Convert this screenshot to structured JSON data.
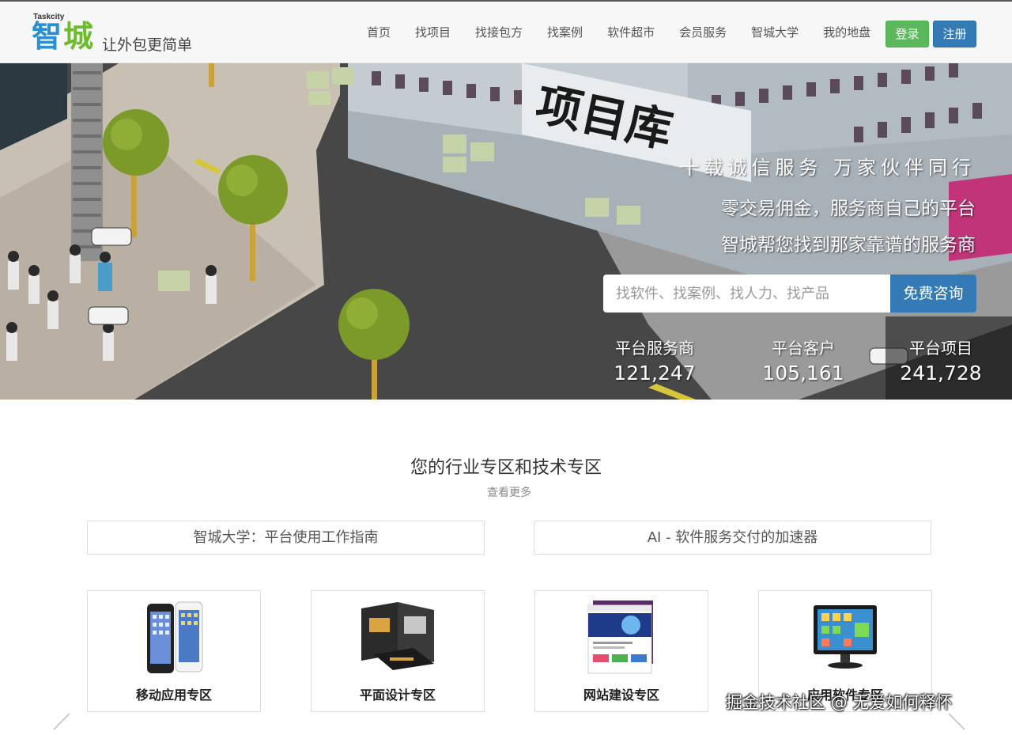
{
  "header": {
    "brand_en": "Taskcity",
    "brand_zh_1": "智",
    "brand_zh_2": "城",
    "slogan": "让外包更简单",
    "nav": [
      "首页",
      "找项目",
      "找接包方",
      "找案例",
      "软件超市",
      "会员服务",
      "智城大学",
      "我的地盘"
    ],
    "login_label": "登录",
    "register_label": "注册"
  },
  "hero": {
    "tagline": "十载诚信服务 万家伙伴同行",
    "subline_1": "零交易佣金，服务商自己的平台",
    "subline_2": "智城帮您找到那家靠谱的服务商",
    "search_placeholder": "找软件、找案例、找人力、找产品",
    "consult_label": "免费咨询",
    "sign_text": "项目库",
    "stats": [
      {
        "label": "平台服务商",
        "value": "121,247"
      },
      {
        "label": "平台客户",
        "value": "105,161"
      },
      {
        "label": "平台项目",
        "value": "241,728"
      }
    ]
  },
  "section": {
    "title": "您的行业专区和技术专区",
    "more": "查看更多",
    "guides": [
      "智城大学：平台使用工作指南",
      "AI - 软件服务交付的加速器"
    ],
    "cards": [
      "移动应用专区",
      "平面设计专区",
      "网站建设专区",
      "应用软件专区"
    ]
  },
  "watermark": "掘金技术社区 @ 无爱如何释怀",
  "colors": {
    "brand_blue": "#2a8fd0",
    "brand_green": "#6cbc2e",
    "login_green": "#5cb85c",
    "primary_blue": "#337ab7"
  }
}
